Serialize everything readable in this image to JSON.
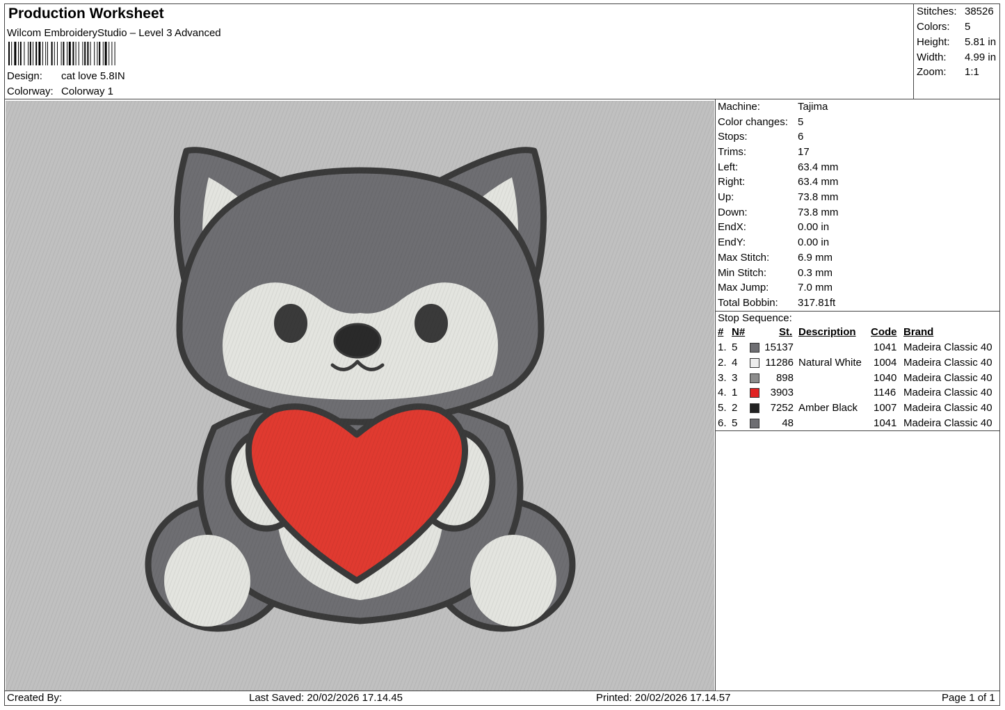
{
  "header": {
    "title": "Production Worksheet",
    "software": "Wilcom EmbroideryStudio – Level 3 Advanced",
    "design_label": "Design:",
    "design_value": "cat love 5.8IN",
    "colorway_label": "Colorway:",
    "colorway_value": "Colorway 1"
  },
  "summary": [
    {
      "label": "Stitches:",
      "value": "38526"
    },
    {
      "label": "Colors:",
      "value": "5"
    },
    {
      "label": "Height:",
      "value": "5.81 in"
    },
    {
      "label": "Width:",
      "value": "4.99 in"
    },
    {
      "label": "Zoom:",
      "value": "1:1"
    }
  ],
  "machine_info": [
    {
      "label": "Machine:",
      "value": "Tajima"
    },
    {
      "label": "Color changes:",
      "value": "5"
    },
    {
      "label": "Stops:",
      "value": "6"
    },
    {
      "label": "Trims:",
      "value": "17"
    },
    {
      "label": "Left:",
      "value": "63.4 mm"
    },
    {
      "label": "Right:",
      "value": "63.4 mm"
    },
    {
      "label": "Up:",
      "value": "73.8 mm"
    },
    {
      "label": "Down:",
      "value": "73.8 mm"
    },
    {
      "label": "EndX:",
      "value": "0.00 in"
    },
    {
      "label": "EndY:",
      "value": "0.00 in"
    },
    {
      "label": "Max Stitch:",
      "value": "6.9 mm"
    },
    {
      "label": "Min Stitch:",
      "value": "0.3 mm"
    },
    {
      "label": "Max Jump:",
      "value": "7.0 mm"
    },
    {
      "label": "Total Bobbin:",
      "value": "317.81ft"
    }
  ],
  "stop_sequence": {
    "title": "Stop Sequence:",
    "headers": {
      "num": "#",
      "n": "N#",
      "st": "St.",
      "desc": "Description",
      "code": "Code",
      "brand": "Brand"
    },
    "rows": [
      {
        "num": "1.",
        "n": "5",
        "color": "#6e6e72",
        "st": "15137",
        "desc": "",
        "code": "1041",
        "brand": "Madeira Classic 40"
      },
      {
        "num": "2.",
        "n": "4",
        "color": "#ececec",
        "st": "11286",
        "desc": "Natural White",
        "code": "1004",
        "brand": "Madeira Classic 40"
      },
      {
        "num": "3.",
        "n": "3",
        "color": "#8c8c8c",
        "st": "898",
        "desc": "",
        "code": "1040",
        "brand": "Madeira Classic 40"
      },
      {
        "num": "4.",
        "n": "1",
        "color": "#e02222",
        "st": "3903",
        "desc": "",
        "code": "1146",
        "brand": "Madeira Classic 40"
      },
      {
        "num": "5.",
        "n": "2",
        "color": "#222222",
        "st": "7252",
        "desc": "Amber Black",
        "code": "1007",
        "brand": "Madeira Classic 40"
      },
      {
        "num": "6.",
        "n": "5",
        "color": "#6e6e72",
        "st": "48",
        "desc": "",
        "code": "1041",
        "brand": "Madeira Classic 40"
      }
    ]
  },
  "footer": {
    "created_by": "Created By:",
    "last_saved": "Last Saved: 20/02/2026 17.14.45",
    "printed": "Printed: 20/02/2026 17.14.57",
    "page": "Page 1 of 1"
  },
  "colors": {
    "background_area": "#c0c0c0",
    "fur_dark": "#6e6e72",
    "fur_light": "#e3e4df",
    "outline": "#3a3a3a",
    "heart": "#e03a30"
  }
}
